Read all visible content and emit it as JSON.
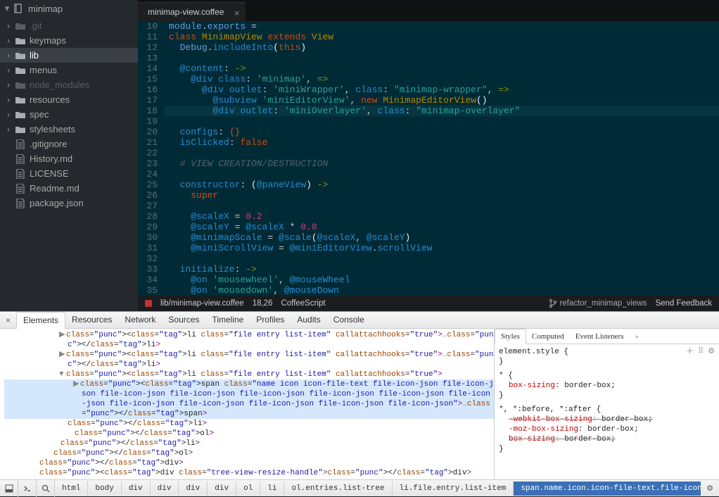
{
  "project": {
    "name": "minimap"
  },
  "sidebar": {
    "items": [
      {
        "label": ".git",
        "type": "folder",
        "dim": true,
        "expand": true
      },
      {
        "label": "keymaps",
        "type": "folder",
        "expand": true
      },
      {
        "label": "lib",
        "type": "folder",
        "sel": true,
        "expand": true
      },
      {
        "label": "menus",
        "type": "folder",
        "expand": true
      },
      {
        "label": "node_modules",
        "type": "folder",
        "dim": true,
        "expand": true
      },
      {
        "label": "resources",
        "type": "folder",
        "expand": true
      },
      {
        "label": "spec",
        "type": "folder",
        "expand": true
      },
      {
        "label": "stylesheets",
        "type": "folder",
        "expand": true
      },
      {
        "label": ".gitignore",
        "type": "file"
      },
      {
        "label": "History.md",
        "type": "file"
      },
      {
        "label": "LICENSE",
        "type": "file"
      },
      {
        "label": "Readme.md",
        "type": "file"
      },
      {
        "label": "package.json",
        "type": "file"
      }
    ]
  },
  "tab": {
    "title": "minimap-view.coffee"
  },
  "code_lines": [
    {
      "n": 10,
      "tokens": [
        [
          "cls",
          "module"
        ],
        [
          "op",
          "."
        ],
        [
          "cls",
          "exports"
        ],
        [
          "op",
          " ="
        ]
      ]
    },
    {
      "n": 11,
      "tokens": [
        [
          "kw",
          "class"
        ],
        [
          "par",
          " "
        ],
        [
          "fn",
          "MinimapView"
        ],
        [
          "par",
          " "
        ],
        [
          "kw",
          "extends"
        ],
        [
          "par",
          " "
        ],
        [
          "fn",
          "View"
        ]
      ]
    },
    {
      "n": 12,
      "tokens": [
        [
          "par",
          "  "
        ],
        [
          "cls",
          "Debug"
        ],
        [
          "op",
          "."
        ],
        [
          "prop",
          "includeInto"
        ],
        [
          "par",
          "("
        ],
        [
          "kw",
          "this"
        ],
        [
          "par",
          ")"
        ]
      ]
    },
    {
      "n": 13,
      "tokens": [
        [
          "par",
          ""
        ]
      ]
    },
    {
      "n": 14,
      "tokens": [
        [
          "par",
          "  "
        ],
        [
          "at",
          "@content"
        ],
        [
          "op",
          ":"
        ],
        [
          "par",
          " "
        ],
        [
          "kw2",
          "->"
        ]
      ]
    },
    {
      "n": 15,
      "tokens": [
        [
          "par",
          "    "
        ],
        [
          "at",
          "@div"
        ],
        [
          "par",
          " "
        ],
        [
          "prop",
          "class"
        ],
        [
          "op",
          ":"
        ],
        [
          "par",
          " "
        ],
        [
          "str",
          "'minimap'"
        ],
        [
          "op",
          ","
        ],
        [
          "par",
          " "
        ],
        [
          "kw2",
          "=>"
        ]
      ]
    },
    {
      "n": 16,
      "tokens": [
        [
          "par",
          "      "
        ],
        [
          "at",
          "@div"
        ],
        [
          "par",
          " "
        ],
        [
          "prop",
          "outlet"
        ],
        [
          "op",
          ":"
        ],
        [
          "par",
          " "
        ],
        [
          "str",
          "'miniWrapper'"
        ],
        [
          "op",
          ","
        ],
        [
          "par",
          " "
        ],
        [
          "prop",
          "class"
        ],
        [
          "op",
          ":"
        ],
        [
          "par",
          " "
        ],
        [
          "str",
          "\"minimap-wrapper\""
        ],
        [
          "op",
          ","
        ],
        [
          "par",
          " "
        ],
        [
          "kw2",
          "=>"
        ]
      ]
    },
    {
      "n": 17,
      "tokens": [
        [
          "par",
          "        "
        ],
        [
          "at",
          "@subview"
        ],
        [
          "par",
          " "
        ],
        [
          "str",
          "'miniEditorView'"
        ],
        [
          "op",
          ","
        ],
        [
          "par",
          " "
        ],
        [
          "kw",
          "new"
        ],
        [
          "par",
          " "
        ],
        [
          "fn",
          "MinimapEditorView"
        ],
        [
          "par",
          "()"
        ]
      ]
    },
    {
      "n": 18,
      "hl": true,
      "tokens": [
        [
          "par",
          "        "
        ],
        [
          "at",
          "@div"
        ],
        [
          "par",
          " "
        ],
        [
          "prop",
          "outlet"
        ],
        [
          "op",
          ":"
        ],
        [
          "par",
          " "
        ],
        [
          "str",
          "'miniOverlayer'"
        ],
        [
          "op",
          ","
        ],
        [
          "par",
          " "
        ],
        [
          "prop",
          "class"
        ],
        [
          "op",
          ":"
        ],
        [
          "par",
          " "
        ],
        [
          "str",
          "\"minimap-overlayer\""
        ]
      ]
    },
    {
      "n": 19,
      "tokens": [
        [
          "par",
          ""
        ]
      ]
    },
    {
      "n": 20,
      "tokens": [
        [
          "par",
          "  "
        ],
        [
          "prop",
          "configs"
        ],
        [
          "op",
          ":"
        ],
        [
          "par",
          " "
        ],
        [
          "kw",
          "{}"
        ]
      ]
    },
    {
      "n": 21,
      "tokens": [
        [
          "par",
          "  "
        ],
        [
          "prop",
          "isClicked"
        ],
        [
          "op",
          ":"
        ],
        [
          "par",
          " "
        ],
        [
          "kw",
          "false"
        ]
      ]
    },
    {
      "n": 22,
      "tokens": [
        [
          "par",
          ""
        ]
      ]
    },
    {
      "n": 23,
      "tokens": [
        [
          "par",
          "  "
        ],
        [
          "cm",
          "# VIEW CREATION/DESTRUCTION"
        ]
      ]
    },
    {
      "n": 24,
      "tokens": [
        [
          "par",
          ""
        ]
      ]
    },
    {
      "n": 25,
      "tokens": [
        [
          "par",
          "  "
        ],
        [
          "prop",
          "constructor"
        ],
        [
          "op",
          ":"
        ],
        [
          "par",
          " ("
        ],
        [
          "at",
          "@paneView"
        ],
        [
          "par",
          ") "
        ],
        [
          "kw2",
          "->"
        ]
      ]
    },
    {
      "n": 26,
      "tokens": [
        [
          "par",
          "    "
        ],
        [
          "kw",
          "super"
        ]
      ]
    },
    {
      "n": 27,
      "tokens": [
        [
          "par",
          ""
        ]
      ]
    },
    {
      "n": 28,
      "tokens": [
        [
          "par",
          "    "
        ],
        [
          "at",
          "@scaleX"
        ],
        [
          "op",
          " = "
        ],
        [
          "num",
          "0.2"
        ]
      ]
    },
    {
      "n": 29,
      "tokens": [
        [
          "par",
          "    "
        ],
        [
          "at",
          "@scaleY"
        ],
        [
          "op",
          " = "
        ],
        [
          "at",
          "@scaleX"
        ],
        [
          "op",
          " * "
        ],
        [
          "num",
          "0.8"
        ]
      ]
    },
    {
      "n": 30,
      "tokens": [
        [
          "par",
          "    "
        ],
        [
          "at",
          "@minimapScale"
        ],
        [
          "op",
          " = "
        ],
        [
          "at",
          "@scale"
        ],
        [
          "par",
          "("
        ],
        [
          "at",
          "@scaleX"
        ],
        [
          "op",
          ","
        ],
        [
          "par",
          " "
        ],
        [
          "at",
          "@scaleY"
        ],
        [
          "par",
          ")"
        ]
      ]
    },
    {
      "n": 31,
      "tokens": [
        [
          "par",
          "    "
        ],
        [
          "at",
          "@miniScrollView"
        ],
        [
          "op",
          " = "
        ],
        [
          "at",
          "@miniEditorView"
        ],
        [
          "op",
          "."
        ],
        [
          "prop",
          "scrollView"
        ]
      ]
    },
    {
      "n": 32,
      "tokens": [
        [
          "par",
          ""
        ]
      ]
    },
    {
      "n": 33,
      "tokens": [
        [
          "par",
          "  "
        ],
        [
          "prop",
          "initialize"
        ],
        [
          "op",
          ":"
        ],
        [
          "par",
          " "
        ],
        [
          "kw2",
          "->"
        ]
      ]
    },
    {
      "n": 34,
      "tokens": [
        [
          "par",
          "    "
        ],
        [
          "at",
          "@on"
        ],
        [
          "par",
          " "
        ],
        [
          "str",
          "'mousewheel'"
        ],
        [
          "op",
          ","
        ],
        [
          "par",
          " "
        ],
        [
          "at",
          "@mouseWheel"
        ]
      ]
    },
    {
      "n": 35,
      "tokens": [
        [
          "par",
          "    "
        ],
        [
          "at",
          "@on"
        ],
        [
          "par",
          " "
        ],
        [
          "str",
          "'mousedown'"
        ],
        [
          "op",
          ","
        ],
        [
          "par",
          " "
        ],
        [
          "at",
          "@mouseDown"
        ]
      ]
    }
  ],
  "status": {
    "path": "lib/minimap-view.coffee",
    "cursor": "18,26",
    "lang": "CoffeeScript",
    "branch": "refactor_minimap_views",
    "feedback": "Send Feedback"
  },
  "devtools": {
    "tabs": [
      "Elements",
      "Resources",
      "Network",
      "Sources",
      "Timeline",
      "Profiles",
      "Audits",
      "Console"
    ],
    "active": 0,
    "elements_html": [
      {
        "indent": "indent2",
        "arrow": "▶",
        "raw": "<li class=\"file entry list-item\" callattachhooks=\"true\">…</li>"
      },
      {
        "indent": "indent2",
        "arrow": "▶",
        "raw": "<li class=\"file entry list-item\" callattachhooks=\"true\">…</li>"
      },
      {
        "indent": "indent2",
        "arrow": "▼",
        "raw": "<li class=\"file entry list-item\" callattachhooks=\"true\">"
      },
      {
        "indent": "indent3",
        "arrow": "▶",
        "hl": true,
        "raw": "<span class=\"name icon icon-file-text file-icon-json file-icon-json file-icon-json file-icon-json file-icon-json file-icon-json file-icon-json file-icon-json file-icon-json file-icon-json file-icon-json file-icon-json file-icon-json\">…</span>"
      },
      {
        "indent": "indent2",
        "arrow": "",
        "raw": "</li>"
      },
      {
        "indent": "indent2b",
        "arrow": "",
        "close": true,
        "raw": "</ol>"
      },
      {
        "indent": "indent1b",
        "arrow": "",
        "close": true,
        "raw": "</li>"
      },
      {
        "indent": "indent1",
        "arrow": "",
        "close": true,
        "raw": "</ol>"
      },
      {
        "indent": "indent0",
        "arrow": "",
        "close": true,
        "raw": "</div>"
      },
      {
        "indent": "indent0",
        "arrow": "",
        "raw": "<div class=\"tree-view-resize-handle\"></div>"
      }
    ],
    "styles": {
      "tabs": [
        "Styles",
        "Computed",
        "Event Listeners"
      ],
      "rules": [
        {
          "selector": "element.style {",
          "decls": [],
          "close": "}"
        },
        {
          "selector": "* {",
          "decls": [
            {
              "p": "box-sizing",
              "v": "border-box;"
            }
          ],
          "close": "}"
        },
        {
          "selector": "*, *:before, *:after {",
          "decls": [
            {
              "p": "-webkit-box-sizing",
              "v": "border-box;",
              "strike": true
            },
            {
              "p": "-moz-box-sizing",
              "v": "border-box;"
            },
            {
              "p": "box-sizing",
              "v": "border-box;",
              "strike": true
            }
          ],
          "close": "}"
        }
      ]
    },
    "crumbs": [
      "html",
      "body",
      "div",
      "div",
      "div",
      "div",
      "ol",
      "li",
      "ol.entries.list-tree",
      "li.file.entry.list-item",
      "span.name.icon.icon-file-text.file-icon-json"
    ]
  }
}
